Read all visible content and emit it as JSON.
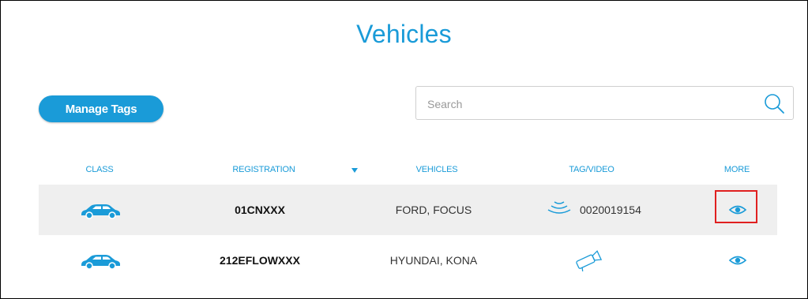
{
  "page": {
    "title": "Vehicles"
  },
  "toolbar": {
    "manage_tags_label": "Manage Tags"
  },
  "search": {
    "placeholder": "Search",
    "value": ""
  },
  "table": {
    "headers": {
      "class": "CLASS",
      "registration": "REGISTRATION",
      "vehicles": "VEHICLES",
      "tag_video": "TAG/VIDEO",
      "more": "MORE"
    },
    "rows": [
      {
        "class_icon": "car-icon",
        "registration": "01CNXXX",
        "vehicle": "FORD, FOCUS",
        "tag_type": "rfid-tag-icon",
        "tag_number": "0020019154",
        "more_icon": "eye-icon"
      },
      {
        "class_icon": "car-icon",
        "registration": "212EFLOWXXX",
        "vehicle": "HYUNDAI, KONA",
        "tag_type": "video-camera-icon",
        "tag_number": "",
        "more_icon": "eye-icon"
      }
    ]
  },
  "colors": {
    "accent": "#1a9bd8",
    "row_shade": "#efefef",
    "highlight": "#e02020"
  }
}
